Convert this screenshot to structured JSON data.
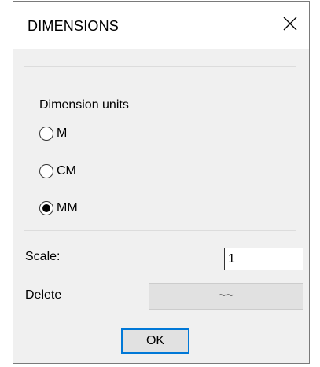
{
  "window": {
    "title": "DIMENSIONS",
    "close_icon": "close-icon"
  },
  "dimension_units": {
    "label": "Dimension units",
    "options": [
      {
        "label": "M",
        "selected": false
      },
      {
        "label": "CM",
        "selected": false
      },
      {
        "label": "MM",
        "selected": true
      }
    ]
  },
  "scale": {
    "label": "Scale:",
    "value": "1"
  },
  "delete": {
    "label": "Delete",
    "button_label": "~~"
  },
  "ok_button": {
    "label": "OK"
  },
  "colors": {
    "accent": "#0078d7",
    "client_background": "#f0f0f0",
    "button_face": "#e1e1e1"
  }
}
